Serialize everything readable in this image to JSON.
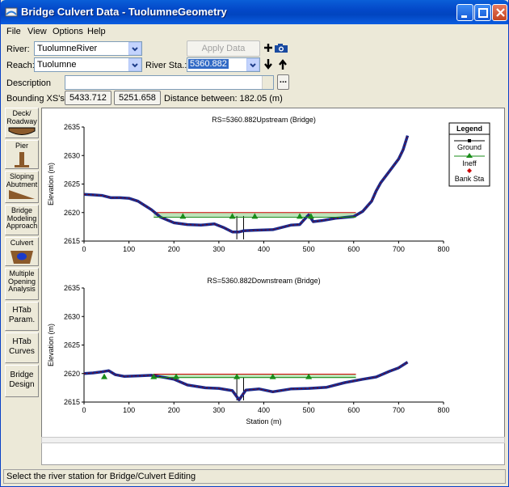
{
  "window": {
    "title": "Bridge Culvert Data - TuolumneGeometry"
  },
  "menu": [
    "File",
    "View",
    "Options",
    "Help"
  ],
  "form": {
    "river_label": "River:",
    "river_value": "TuolumneRiver",
    "reach_label": "Reach:",
    "reach_value": "Tuolumne",
    "station_label": "River Sta.:",
    "station_value": "5360.882",
    "apply_label": "Apply Data",
    "description_label": "Description",
    "description_value": "",
    "bounding_label": "Bounding XS's:",
    "bounding_up": "5433.712",
    "bounding_down": "5251.658",
    "distance_text": "Distance between: 182.05 (m)",
    "ellipsis": "..."
  },
  "side_buttons": [
    {
      "label": "Deck/ Roadway",
      "icon": "deck-roadway-icon"
    },
    {
      "label": "Pier",
      "icon": "pier-icon"
    },
    {
      "label": "Sloping Abutment",
      "icon": "sloping-abutment-icon"
    },
    {
      "label": "Bridge Modeling Approach",
      "icon": ""
    },
    {
      "label": "Culvert",
      "icon": "culvert-icon"
    },
    {
      "label": "Multiple Opening Analysis",
      "icon": ""
    },
    {
      "label": "HTab Param.",
      "icon": ""
    },
    {
      "label": "HTab Curves",
      "icon": ""
    },
    {
      "label": "Bridge Design",
      "icon": ""
    }
  ],
  "legend": {
    "title": "Legend",
    "items": [
      "Ground",
      "Ineff",
      "Bank Sta"
    ]
  },
  "colors": {
    "ground": "#1a2a8c",
    "ground_edge": "#8b0000",
    "ineff": "#1a8c1a",
    "deck": "#cc0000",
    "fill": "#bde3b8"
  },
  "chart_data": [
    {
      "type": "line",
      "title": "RS=5360.882Upstream  (Bridge)",
      "xlabel": "",
      "ylabel": "Elevation (m)",
      "xlim": [
        0,
        800
      ],
      "ylim": [
        2615,
        2635
      ],
      "xticks": [
        0,
        100,
        200,
        300,
        400,
        500,
        600,
        700,
        800
      ],
      "yticks": [
        2615,
        2620,
        2625,
        2630,
        2635
      ],
      "series": [
        {
          "name": "Ground",
          "x": [
            0,
            20,
            40,
            60,
            80,
            100,
            120,
            150,
            170,
            200,
            230,
            260,
            290,
            310,
            330,
            345,
            355,
            380,
            420,
            460,
            480,
            495,
            500,
            510,
            530,
            560,
            600,
            620,
            640,
            650,
            660,
            680,
            700,
            710,
            720
          ],
          "y": [
            2623.2,
            2623.1,
            2623,
            2622.6,
            2622.6,
            2622.5,
            2622.0,
            2620.5,
            2619.2,
            2618.2,
            2617.9,
            2617.8,
            2618.0,
            2617.4,
            2616.6,
            2616.6,
            2616.8,
            2616.9,
            2617.0,
            2617.8,
            2617.9,
            2619.2,
            2619.6,
            2618.4,
            2618.6,
            2619.0,
            2619.3,
            2620.2,
            2622.0,
            2623.8,
            2625.2,
            2627.3,
            2629.4,
            2631.0,
            2633.5
          ]
        },
        {
          "name": "Ineff",
          "x": [
            155,
            605
          ],
          "y": [
            2619.2,
            2619.2
          ]
        }
      ],
      "deck": {
        "x": [
          155,
          605
        ],
        "top": 2620.0,
        "bottom": 2619.4
      },
      "ineff_points": [
        220,
        330,
        380,
        480,
        505
      ],
      "bridge_x": [
        340,
        355
      ]
    },
    {
      "type": "line",
      "title": "RS=5360.882Downstream  (Bridge)",
      "xlabel": "Station (m)",
      "ylabel": "Elevation (m)",
      "xlim": [
        0,
        800
      ],
      "ylim": [
        2615,
        2635
      ],
      "xticks": [
        0,
        100,
        200,
        300,
        400,
        500,
        600,
        700,
        800
      ],
      "yticks": [
        2615,
        2620,
        2625,
        2630,
        2635
      ],
      "series": [
        {
          "name": "Ground",
          "x": [
            0,
            20,
            40,
            55,
            70,
            90,
            120,
            150,
            180,
            200,
            230,
            270,
            300,
            330,
            345,
            360,
            390,
            420,
            460,
            500,
            540,
            580,
            620,
            650,
            680,
            700,
            720
          ],
          "y": [
            2620.0,
            2620.1,
            2620.3,
            2620.5,
            2619.8,
            2619.5,
            2619.6,
            2619.7,
            2619.3,
            2619.0,
            2618.0,
            2617.5,
            2617.4,
            2617.0,
            2615.4,
            2617.1,
            2617.3,
            2616.8,
            2617.3,
            2617.4,
            2617.6,
            2618.4,
            2619.0,
            2619.4,
            2620.4,
            2621.0,
            2622.0
          ]
        },
        {
          "name": "Ineff",
          "x": [
            155,
            605
          ],
          "y": [
            2619.3,
            2619.3
          ]
        }
      ],
      "deck": {
        "x": [
          155,
          605
        ],
        "top": 2619.9,
        "bottom": 2619.3
      },
      "ineff_points": [
        45,
        155,
        205,
        340,
        420,
        500
      ],
      "bridge_x": [
        340,
        355
      ]
    }
  ]
}
